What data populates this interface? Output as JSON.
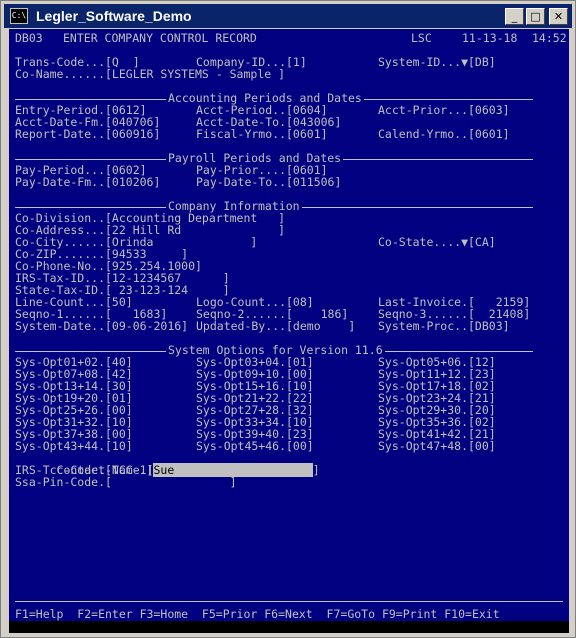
{
  "window": {
    "title": "Legler_Software_Demo",
    "icon": "C:\\",
    "btn_min": "_",
    "btn_max": "□",
    "btn_close": "✕"
  },
  "header": {
    "screen_id": "DB03",
    "screen_title": "ENTER COMPANY CONTROL RECORD",
    "user": "LSC",
    "date": "11-13-18",
    "time": "14:52"
  },
  "top": {
    "trans_code": "Trans-Code...[Q  ]",
    "company_id": "Company-ID...[1]",
    "system_id": "System-ID...▼[DB]",
    "co_name": "Co-Name......[LEGLER SYSTEMS - Sample ]"
  },
  "sections": {
    "accounting": "Accounting Periods and Dates",
    "payroll": "Payroll Periods and Dates",
    "company": "Company Information",
    "sysopt": "System Options for Version 11.6"
  },
  "accounting": [
    [
      "Entry-Period.[0612]",
      "Acct-Period..[0604]",
      "Acct-Prior...[0603]"
    ],
    [
      "Acct-Date-Fm.[040706]",
      "Acct-Date-To.[043006]",
      ""
    ],
    [
      "Report-Date..[060916]",
      "Fiscal-Yrmo..[0601]",
      "Calend-Yrmo..[0601]"
    ]
  ],
  "payroll": [
    [
      "Pay-Period...[0602]",
      "Pay-Prior....[0601]"
    ],
    [
      "Pay-Date-Fm..[010206]",
      "Pay-Date-To..[011506]"
    ]
  ],
  "company": {
    "division": "Co-Division..[Accounting Department   ]",
    "address": "Co-Address...[22 Hill Rd              ]",
    "city": "Co-City......[Orinda              ]",
    "state": "Co-State....▼[CA]",
    "zip": "Co-ZIP.......[94533     ]",
    "phone": "Co-Phone-No..[925.254.1000]",
    "irs": "IRS-Tax-ID...[12-1234567      ]",
    "state_tax": "State-Tax-ID.[ 23-123-124     ]",
    "line_count": "Line-Count...[50]",
    "logo_count": "Logo-Count...[08]",
    "last_invoice": "Last-Invoice.[   2159]",
    "seqno1": "Seqno-1......[   1683]",
    "seqno2": "Seqno-2......[    186]",
    "seqno3": "Seqno-3......[  21408]",
    "system_date": "System-Date..[09-06-2016]",
    "updated_by": "Updated-By...[demo    ]",
    "system_proc": "System-Proc..[DB03]"
  },
  "sysopt": [
    [
      "Sys-Opt01+02.[40]",
      "Sys-Opt03+04.[01]",
      "Sys-Opt05+06.[12]"
    ],
    [
      "Sys-Opt07+08.[42]",
      "Sys-Opt09+10.[00]",
      "Sys-Opt11+12.[23]"
    ],
    [
      "Sys-Opt13+14.[30]",
      "Sys-Opt15+16.[10]",
      "Sys-Opt17+18.[02]"
    ],
    [
      "Sys-Opt19+20.[01]",
      "Sys-Opt21+22.[22]",
      "Sys-Opt23+24.[21]"
    ],
    [
      "Sys-Opt25+26.[00]",
      "Sys-Opt27+28.[32]",
      "Sys-Opt29+30.[20]"
    ],
    [
      "Sys-Opt31+32.[10]",
      "Sys-Opt33+34.[10]",
      "Sys-Opt35+36.[02]"
    ],
    [
      "Sys-Opt37+38.[00]",
      "Sys-Opt39+40.[23]",
      "Sys-Opt41+42.[21]"
    ],
    [
      "Sys-Opt43+44.[10]",
      "Sys-Opt45+46.[00]",
      "Sys-Opt47+48.[00]"
    ]
  ],
  "contact": {
    "contact_label": "Contact-Name.[",
    "contact_value": "Sue                    ",
    "contact_close": "]",
    "irs_tcc": "IRS-Tcc-Code.[TCC-1]",
    "ssa_pin": "Ssa-Pin-Code.[                 ]"
  },
  "footer": {
    "fkeys": "F1=Help  F2=Enter F3=Home  F5=Prior F6=Next  F7=GoTo F9=Print F10=Exit"
  },
  "colors": {
    "console_bg": "#000080",
    "console_fg": "#c0c0c0",
    "titlebar": "#0a246a"
  }
}
